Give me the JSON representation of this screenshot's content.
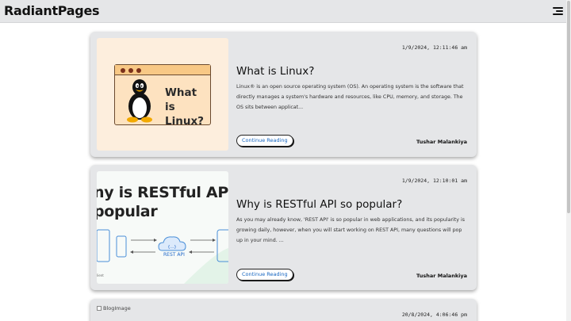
{
  "header": {
    "logo": "RadiantPages"
  },
  "posts": [
    {
      "timestamp": "1/9/2024, 12:11:46 am",
      "title": "What is Linux?",
      "excerpt": "Linux® is an open source operating system (OS). An operating system is the software that directly manages a system's hardware and resources, like CPU, memory, and storage. The OS sits between applicat...",
      "button": "Continue Reading",
      "author": "Tushar Malankiya",
      "image_text": [
        "What is",
        "Linux?"
      ]
    },
    {
      "timestamp": "1/9/2024, 12:10:01 am",
      "title": "Why is RESTful API so popular?",
      "excerpt": "As you may already know, 'REST API' is so popular in web applications, and its popularity is growing daily, however, when you will start working on REST API, many questions will pop up in your mind. ...",
      "button": "Continue Reading",
      "author": "Tushar Malankiya",
      "image_text": [
        "ny is RESTful API",
        "popular"
      ],
      "image_label": "REST API",
      "image_small": "lient",
      "image_cloud": "{...}"
    },
    {
      "timestamp": "20/8/2024, 4:06:46 pm",
      "image_alt": "BlogImage"
    }
  ],
  "colors": {
    "card_bg": "#e5e6e8",
    "link": "#1565c0",
    "linux_bg": "#fdeedd",
    "rest_accent": "#1e66c8"
  }
}
